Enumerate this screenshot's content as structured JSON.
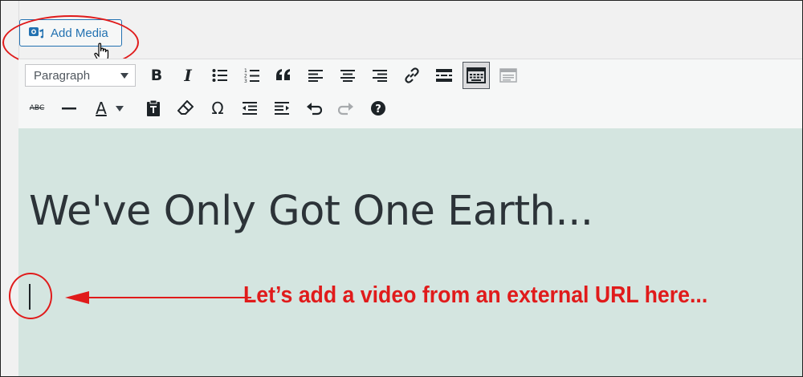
{
  "media": {
    "add_media_label": "Add Media"
  },
  "toolbar": {
    "format_select": "Paragraph",
    "row1": [
      "bold-icon",
      "italic-icon",
      "bulleted-list-icon",
      "numbered-list-icon",
      "blockquote-icon",
      "align-left-icon",
      "align-center-icon",
      "align-right-icon",
      "insert-link-icon",
      "read-more-icon",
      "toolbar-toggle-icon",
      "distraction-free-icon"
    ],
    "row2": [
      "strikethrough-icon",
      "horizontal-line-icon",
      "text-color-icon",
      "paste-as-text-icon",
      "clear-formatting-icon",
      "special-character-icon",
      "decrease-indent-icon",
      "increase-indent-icon",
      "undo-icon",
      "redo-icon",
      "keyboard-shortcuts-icon"
    ],
    "bold_glyph": "B",
    "italic_glyph": "I",
    "omega_glyph": "Ω",
    "text_color_glyph": "A",
    "strike_glyph": "ABC"
  },
  "content": {
    "heading": "We've Only Got One Earth..."
  },
  "annotation": {
    "text": "Let’s add a video from an external URL here..."
  },
  "colors": {
    "accent": "#2271b1",
    "annotation_red": "#e01b1b",
    "content_bg": "#d4e5e0"
  }
}
